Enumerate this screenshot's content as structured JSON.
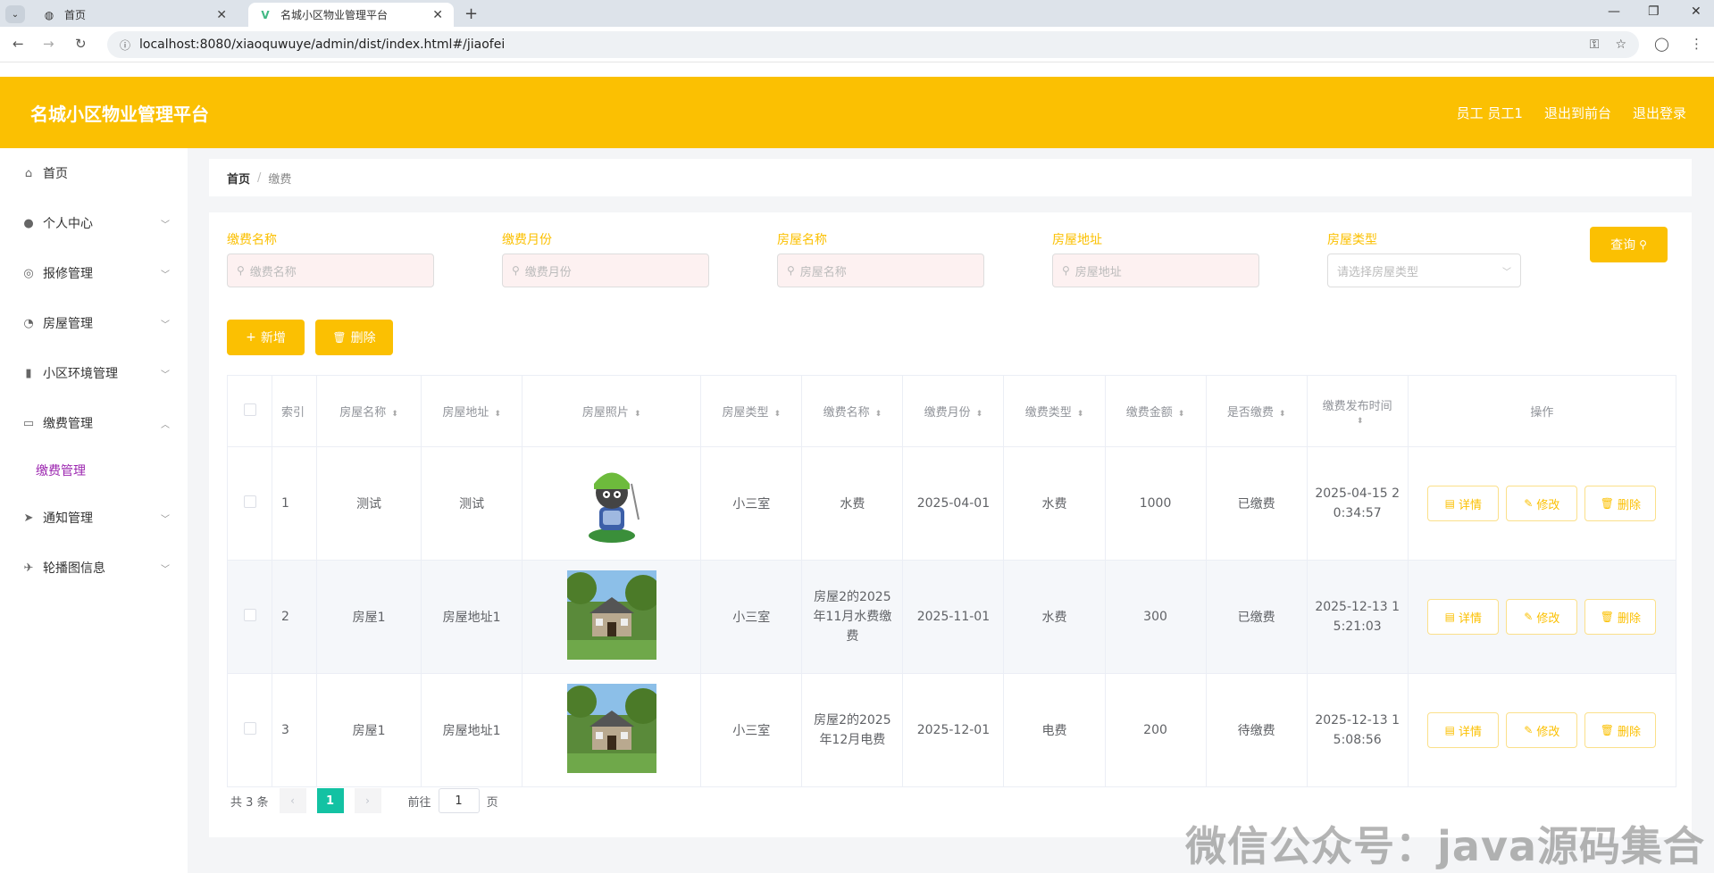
{
  "browser": {
    "tabs": [
      {
        "title": "首页",
        "active": false
      },
      {
        "title": "名城小区物业管理平台",
        "active": true
      }
    ],
    "url": "localhost:8080/xiaoquwuye/admin/dist/index.html#/jiaofei"
  },
  "header": {
    "title": "名城小区物业管理平台",
    "links": [
      "员工 员工1",
      "退出到前台",
      "退出登录"
    ]
  },
  "sidebar": {
    "items": [
      {
        "label": "首页",
        "icon": "home-icon",
        "expandable": false
      },
      {
        "label": "个人中心",
        "icon": "user-icon",
        "expandable": true
      },
      {
        "label": "报修管理",
        "icon": "settings-icon",
        "expandable": true
      },
      {
        "label": "房屋管理",
        "icon": "compass-icon",
        "expandable": true
      },
      {
        "label": "小区环境管理",
        "icon": "bar-chart-icon",
        "expandable": true
      },
      {
        "label": "缴费管理",
        "icon": "message-icon",
        "expandable": true,
        "expanded": true
      },
      {
        "label": "通知管理",
        "icon": "send-icon",
        "expandable": true
      },
      {
        "label": "轮播图信息",
        "icon": "paper-plane-icon",
        "expandable": true
      }
    ],
    "active_sub": "缴费管理"
  },
  "breadcrumb": {
    "home": "首页",
    "sep": "/",
    "current": "缴费"
  },
  "filters": [
    {
      "label": "缴费名称",
      "placeholder": "缴费名称"
    },
    {
      "label": "缴费月份",
      "placeholder": "缴费月份"
    },
    {
      "label": "房屋名称",
      "placeholder": "房屋名称"
    },
    {
      "label": "房屋地址",
      "placeholder": "房屋地址"
    },
    {
      "label": "房屋类型",
      "placeholder": "请选择房屋类型"
    }
  ],
  "buttons": {
    "query": "查询",
    "add": "新增",
    "delete": "删除"
  },
  "table": {
    "columns": [
      "索引",
      "房屋名称",
      "房屋地址",
      "房屋照片",
      "房屋类型",
      "缴费名称",
      "缴费月份",
      "缴费类型",
      "缴费金额",
      "是否缴费",
      "缴费发布时间",
      "操作"
    ],
    "ops": [
      "详情",
      "修改",
      "删除"
    ],
    "rows": [
      {
        "index": "1",
        "name": "测试",
        "address": "测试",
        "photo": "cartoon",
        "type": "小三室",
        "fee_name": "水费",
        "month": "2025-04-01",
        "fee_type": "水费",
        "amount": "1000",
        "paid": "已缴费",
        "time": "2025-04-15 2\n0:34:57"
      },
      {
        "index": "2",
        "name": "房屋1",
        "address": "房屋地址1",
        "photo": "house",
        "type": "小三室",
        "fee_name": "房屋2的2025年11月水费缴费",
        "month": "2025-11-01",
        "fee_type": "水费",
        "amount": "300",
        "paid": "已缴费",
        "time": "2025-12-13 1\n5:21:03"
      },
      {
        "index": "3",
        "name": "房屋1",
        "address": "房屋地址1",
        "photo": "house",
        "type": "小三室",
        "fee_name": "房屋2的2025年12月电费",
        "month": "2025-12-01",
        "fee_type": "电费",
        "amount": "200",
        "paid": "待缴费",
        "time": "2025-12-13 1\n5:08:56"
      }
    ]
  },
  "pagination": {
    "total": "共 3 条",
    "current": "1",
    "goto_prefix": "前往",
    "goto_value": "1",
    "goto_suffix": "页"
  },
  "watermark": "微信公众号：java源码集合",
  "colors": {
    "accent": "#fbc002",
    "pager_active": "#13c2a3",
    "sub_active": "#9c27b0"
  }
}
